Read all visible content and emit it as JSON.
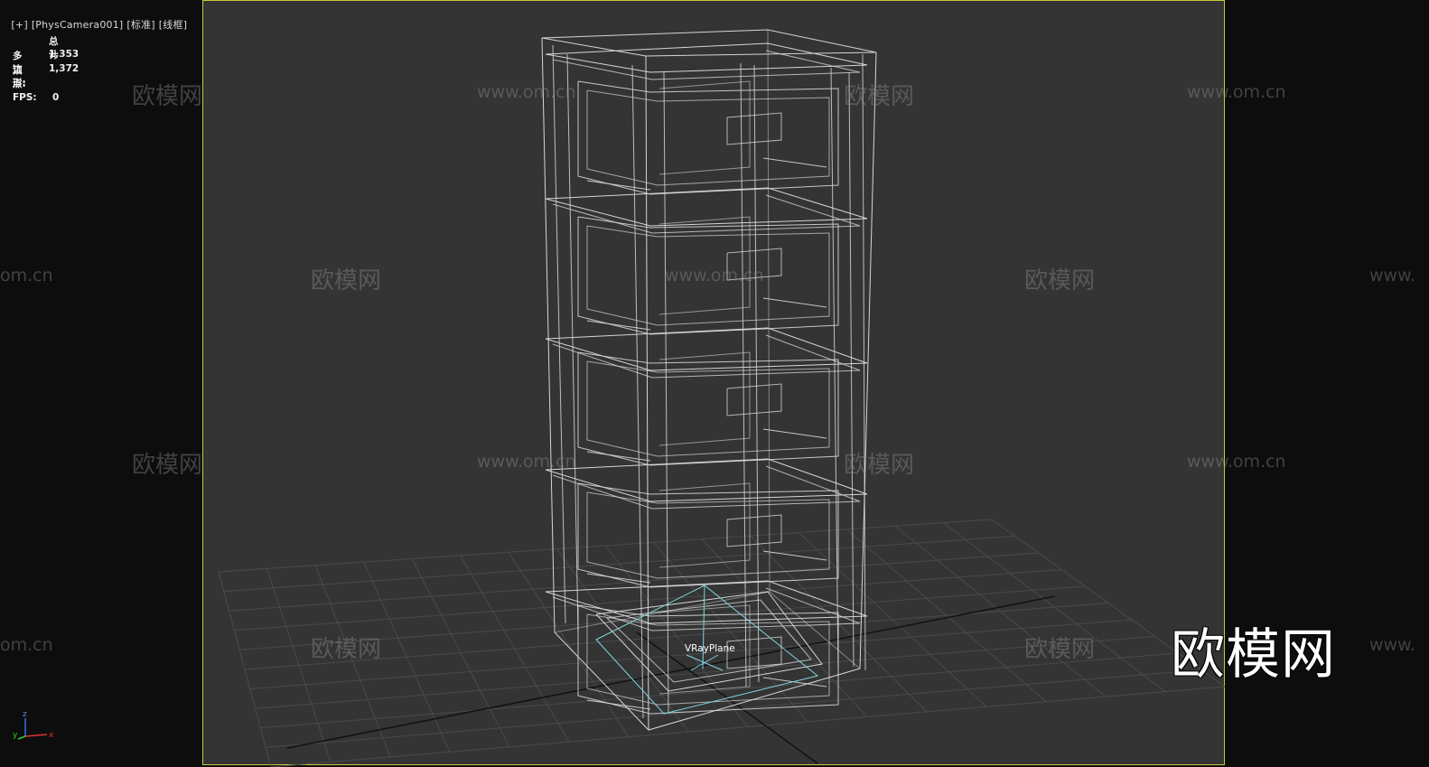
{
  "viewport": {
    "menu": [
      "[+]",
      "[PhysCamera001]",
      "[标准]",
      "[线框]"
    ],
    "accent_border": "#c8c83c",
    "bg_color": "#343434"
  },
  "stats": {
    "header": "总计",
    "polys_label": "多边形:",
    "polys_value": "1,353",
    "verts_label": "顶点:",
    "verts_value": "1,372",
    "fps_label": "FPS:",
    "fps_value": "0"
  },
  "scene": {
    "object_label": "VRayPlane"
  },
  "watermarks": {
    "logo": "欧模网",
    "url": "www.om.cn",
    "url_short": "om.cn",
    "url_cut": "www."
  },
  "axis": {
    "x": "x",
    "y": "y",
    "z": "z"
  }
}
